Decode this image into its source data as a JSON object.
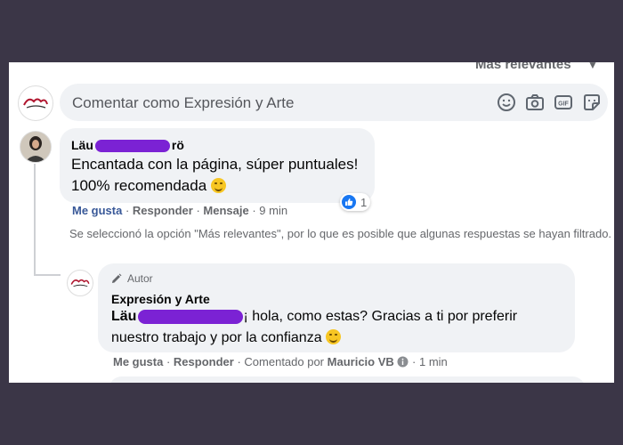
{
  "sort": {
    "label": "Más relevantes"
  },
  "compose": {
    "placeholder": "Comentar como Expresión y Arte"
  },
  "comment": {
    "author_prefix": "Läu",
    "author_suffix": "rö",
    "text_line1": "Encantada con la página, súper puntuales!",
    "text_line2": "100% recomendada",
    "reaction_count": "1",
    "actions": {
      "like": "Me gusta",
      "reply": "Responder",
      "message": "Mensaje",
      "time": "9 min"
    }
  },
  "notice": "Se seleccionó la opción \"Más relevantes\", por lo que es posible que algunas respuestas se hayan filtrado.",
  "reply": {
    "badge": "Autor",
    "author": "Expresión y Arte",
    "mention_prefix": "Läu",
    "text_line1_rest": "¡ hola, como estas? Gracias a ti por preferir",
    "text_line2": "nuestro trabajo y por la confianza",
    "actions": {
      "like": "Me gusta",
      "reply": "Responder",
      "posted_by": "Comentado por",
      "poster": "Mauricio VB",
      "time": "1 min"
    }
  },
  "colors": {
    "accent": "#1877f2",
    "redaction": "#7b22d4",
    "bubble": "#f0f2f5",
    "background": "#3b3647"
  },
  "icons": [
    "emoji-icon",
    "camera-icon",
    "gif-icon",
    "sticker-icon",
    "like-reaction-icon",
    "pencil-icon",
    "info-icon",
    "chevron-down-icon"
  ]
}
